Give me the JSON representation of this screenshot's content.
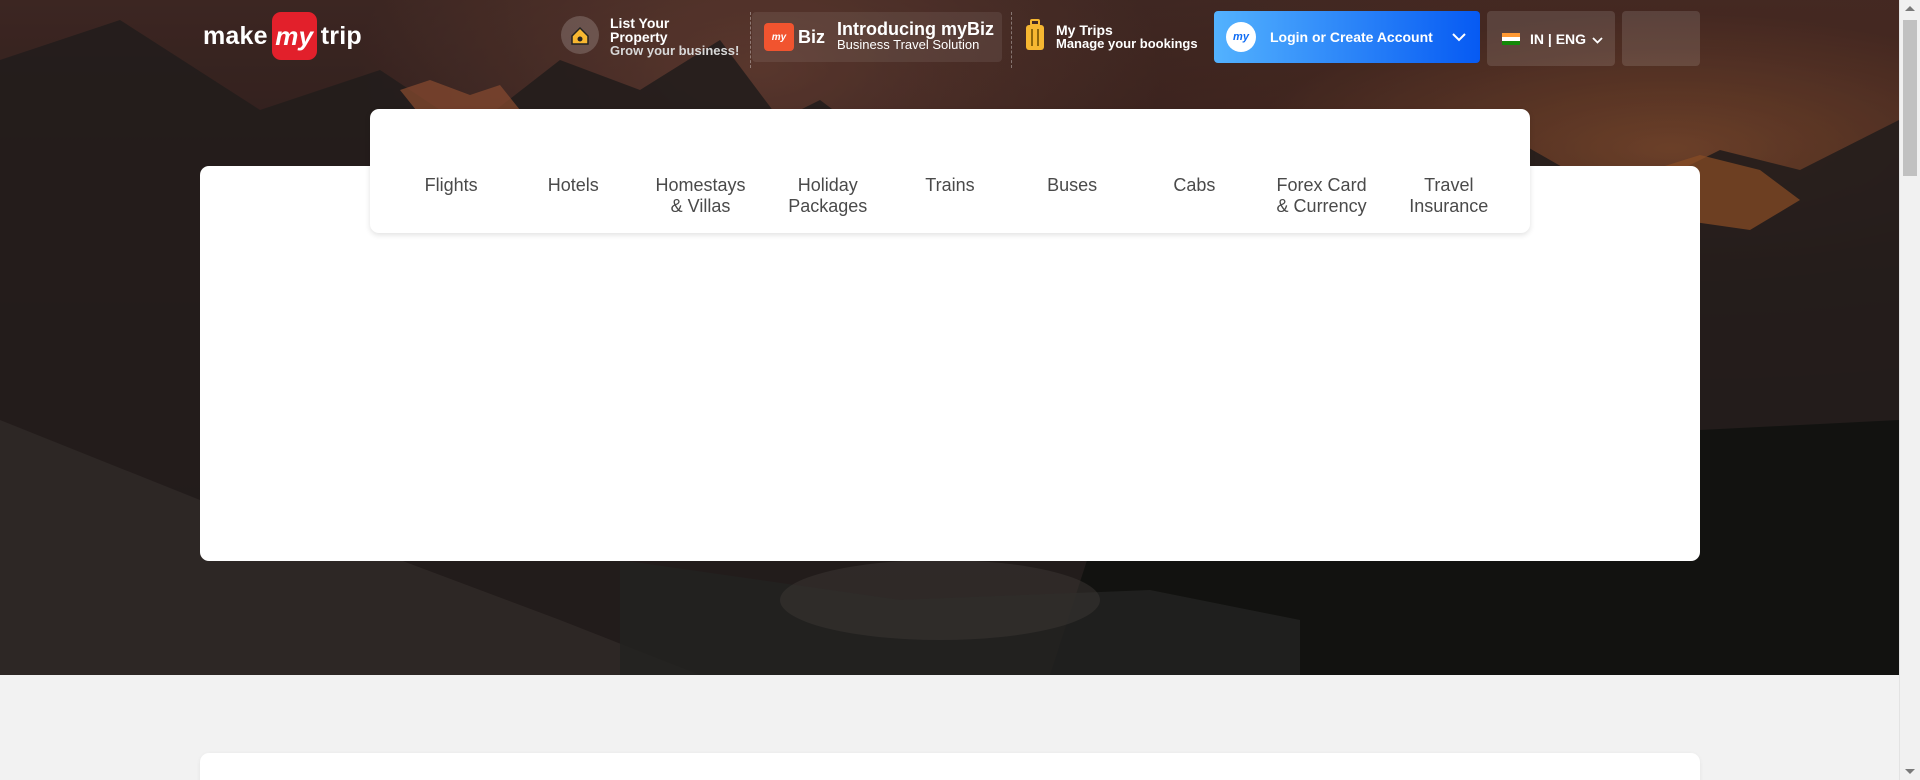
{
  "brand": {
    "logo_left": "make",
    "logo_badge": "my",
    "logo_right": "trip",
    "accent_red": "#e2202b",
    "accent_blue": "#065af3"
  },
  "header": {
    "list_property": {
      "title": "List Your Property",
      "subtitle": "Grow your business!",
      "icon": "house-icon"
    },
    "mybiz": {
      "badge": "my",
      "badge_word": "Biz",
      "title": "Introducing myBiz",
      "subtitle": "Business Travel Solution",
      "icon": "briefcase-icon"
    },
    "my_trips": {
      "title": "My Trips",
      "subtitle": "Manage your bookings",
      "icon": "suitcase-icon"
    },
    "login": {
      "badge": "my",
      "label": "Login or Create Account",
      "icon": "chevron-down-icon"
    },
    "language": {
      "label": "IN | ENG",
      "icon": "india-flag-icon"
    }
  },
  "nav": {
    "items": [
      {
        "line1": "Flights",
        "line2": ""
      },
      {
        "line1": "Hotels",
        "line2": ""
      },
      {
        "line1": "Homestays",
        "line2": "& Villas"
      },
      {
        "line1": "Holiday",
        "line2": "Packages"
      },
      {
        "line1": "Trains",
        "line2": ""
      },
      {
        "line1": "Buses",
        "line2": ""
      },
      {
        "line1": "Cabs",
        "line2": ""
      },
      {
        "line1": "Forex Card",
        "line2": "& Currency"
      },
      {
        "line1": "Travel",
        "line2": "Insurance"
      }
    ]
  }
}
